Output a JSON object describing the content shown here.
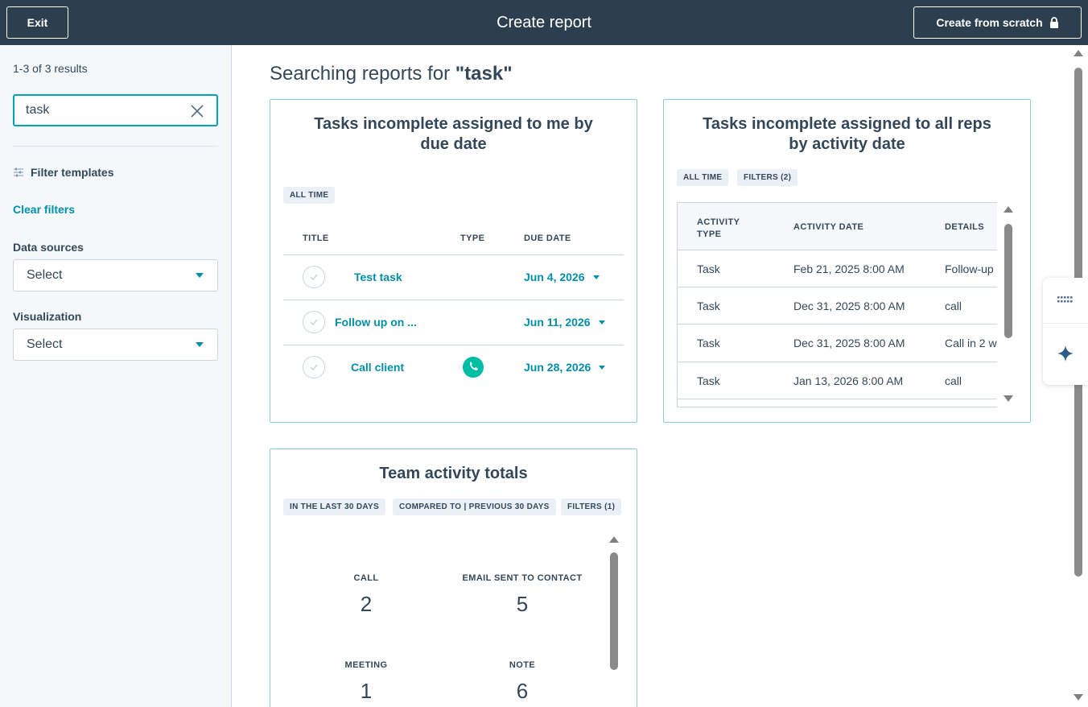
{
  "header": {
    "exit_label": "Exit",
    "title": "Create report",
    "create_from_scratch_label": "Create from scratch"
  },
  "sidebar": {
    "results_count": "1-3 of 3 results",
    "search": {
      "value": "task",
      "placeholder": ""
    },
    "filter_templates_label": "Filter templates",
    "clear_filters_label": "Clear filters",
    "data_sources": {
      "label": "Data sources",
      "value": "Select"
    },
    "visualization": {
      "label": "Visualization",
      "value": "Select"
    }
  },
  "main": {
    "heading_prefix": "Searching reports for ",
    "heading_query": "\"task\"",
    "card1": {
      "title": "Tasks incomplete assigned to me by due date",
      "tags": [
        "ALL TIME"
      ],
      "columns": [
        "TITLE",
        "TYPE",
        "DUE DATE"
      ],
      "rows": [
        {
          "title": "Test task",
          "type": "",
          "due": "Jun 4, 2026"
        },
        {
          "title": "Follow up on ...",
          "type": "",
          "due": "Jun 11, 2026"
        },
        {
          "title": "Call client",
          "type": "phone-icon",
          "due": "Jun 28, 2026"
        }
      ]
    },
    "card2": {
      "title": "Tasks incomplete assigned to all reps by activity date",
      "tags": [
        "ALL TIME",
        "FILTERS (2)"
      ],
      "columns": [
        "ACTIVITY TYPE",
        "ACTIVITY DATE",
        "DETAILS"
      ],
      "rows": [
        {
          "type": "Task",
          "date": "Feb 21, 2025 8:00 AM",
          "details": "Follow-up"
        },
        {
          "type": "Task",
          "date": "Dec 31, 2025 8:00 AM",
          "details": "call"
        },
        {
          "type": "Task",
          "date": "Dec 31, 2025 8:00 AM",
          "details": "Call in 2 w"
        },
        {
          "type": "Task",
          "date": "Jan 13, 2026 8:00 AM",
          "details": "call"
        }
      ]
    },
    "card3": {
      "title": "Team activity totals",
      "tags": [
        "IN THE LAST 30 DAYS",
        "COMPARED TO | PREVIOUS 30 DAYS",
        "FILTERS (1)"
      ],
      "stats": [
        {
          "label": "CALL",
          "value": "2"
        },
        {
          "label": "EMAIL SENT TO CONTACT",
          "value": "5"
        },
        {
          "label": "MEETING",
          "value": "1"
        },
        {
          "label": "NOTE",
          "value": "6"
        }
      ]
    }
  },
  "colors": {
    "header_bg": "#2d3e50",
    "accent": "#0091ae",
    "focus": "#00a4bd",
    "phone": "#00bda5",
    "card_border": "#7fd1de"
  },
  "icons": {
    "lock": "lock-icon",
    "clear": "close-icon",
    "filter": "sliders-icon",
    "caret": "caret-down-icon",
    "phone": "phone-icon",
    "grid": "grid-dots-icon",
    "sparkle": "sparkle-icon"
  }
}
